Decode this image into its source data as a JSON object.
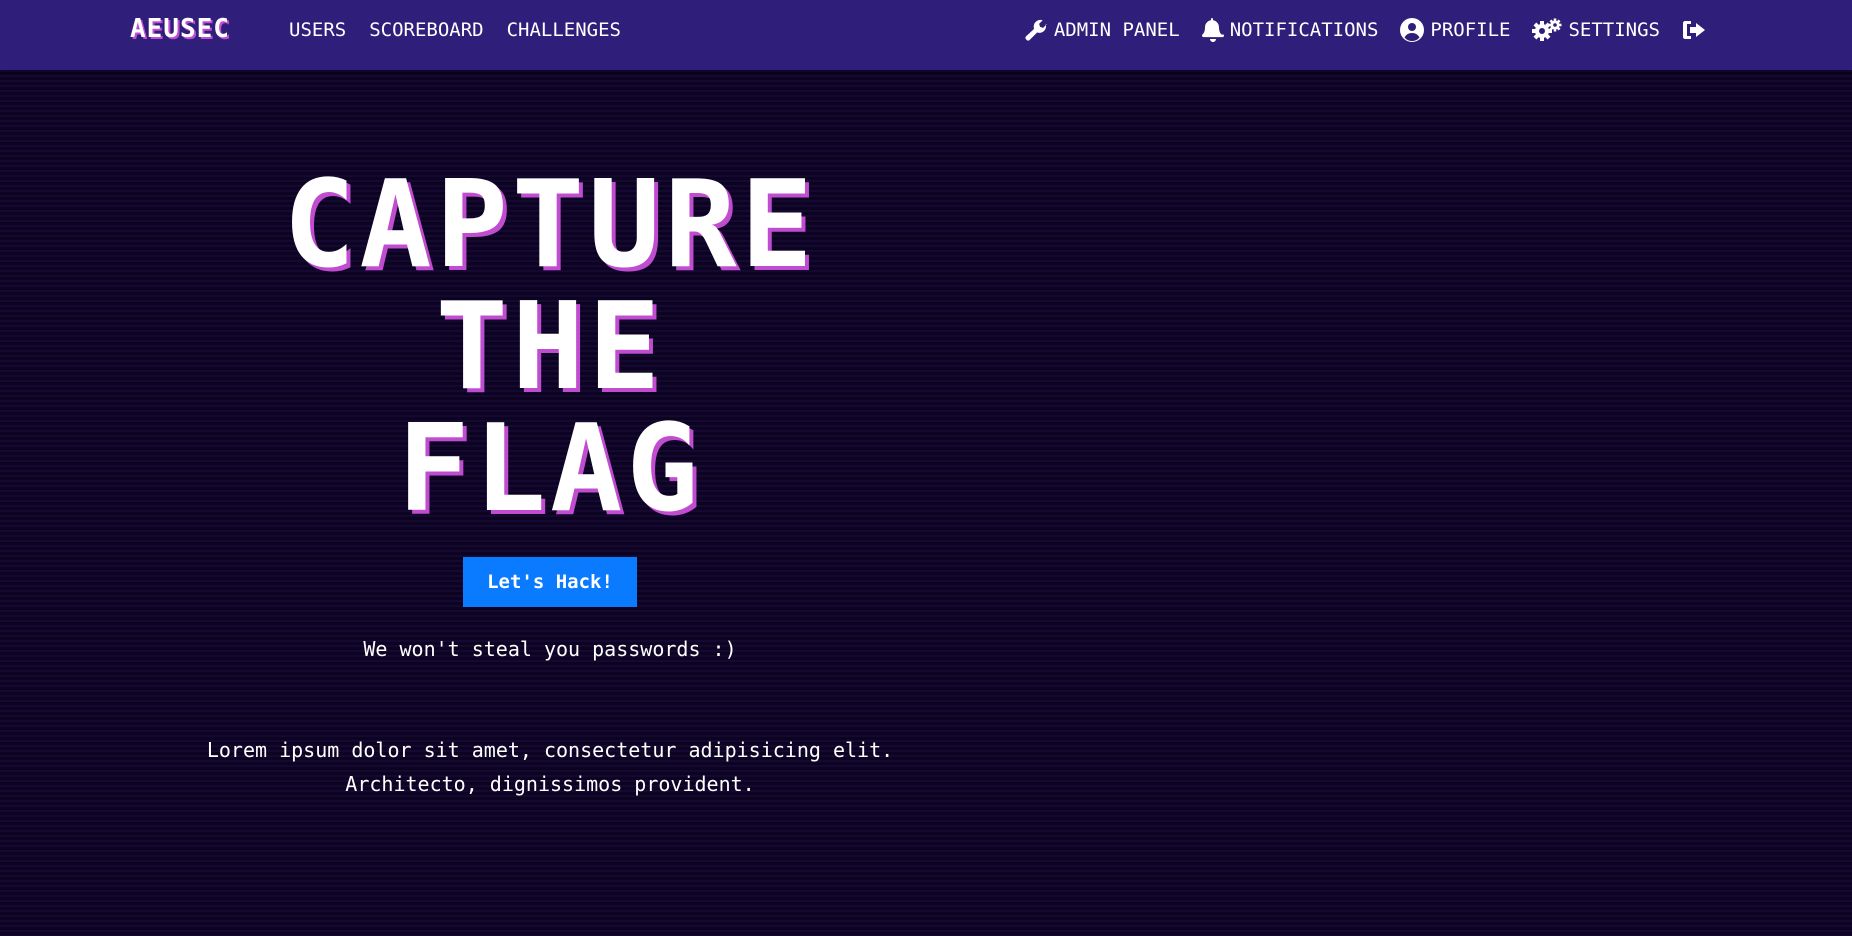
{
  "navbar": {
    "brand": "AEUSEC",
    "left_links": [
      {
        "label": "USERS"
      },
      {
        "label": "SCOREBOARD"
      },
      {
        "label": "CHALLENGES"
      }
    ],
    "right_links": [
      {
        "label": "ADMIN PANEL",
        "icon": "wrench-icon"
      },
      {
        "label": "NOTIFICATIONS",
        "icon": "bell-icon"
      },
      {
        "label": "PROFILE",
        "icon": "user-circle-icon"
      },
      {
        "label": "SETTINGS",
        "icon": "cogs-icon"
      },
      {
        "label": "",
        "icon": "logout-icon"
      }
    ]
  },
  "hero": {
    "title_lines": [
      "CAPTURE",
      "THE",
      "FLAG"
    ],
    "cta_label": "Let's Hack!",
    "subtitle": "We won't steal you passwords :)",
    "description_lines": [
      "Lorem ipsum dolor sit amet, consectetur adipisicing elit.",
      "Architecto, dignissimos provident."
    ]
  },
  "colors": {
    "navbar_bg": "#2f1f7a",
    "page_bg": "#0b0320",
    "title_shadow": "#c04cd0",
    "cta_bg": "#0a7bff"
  }
}
